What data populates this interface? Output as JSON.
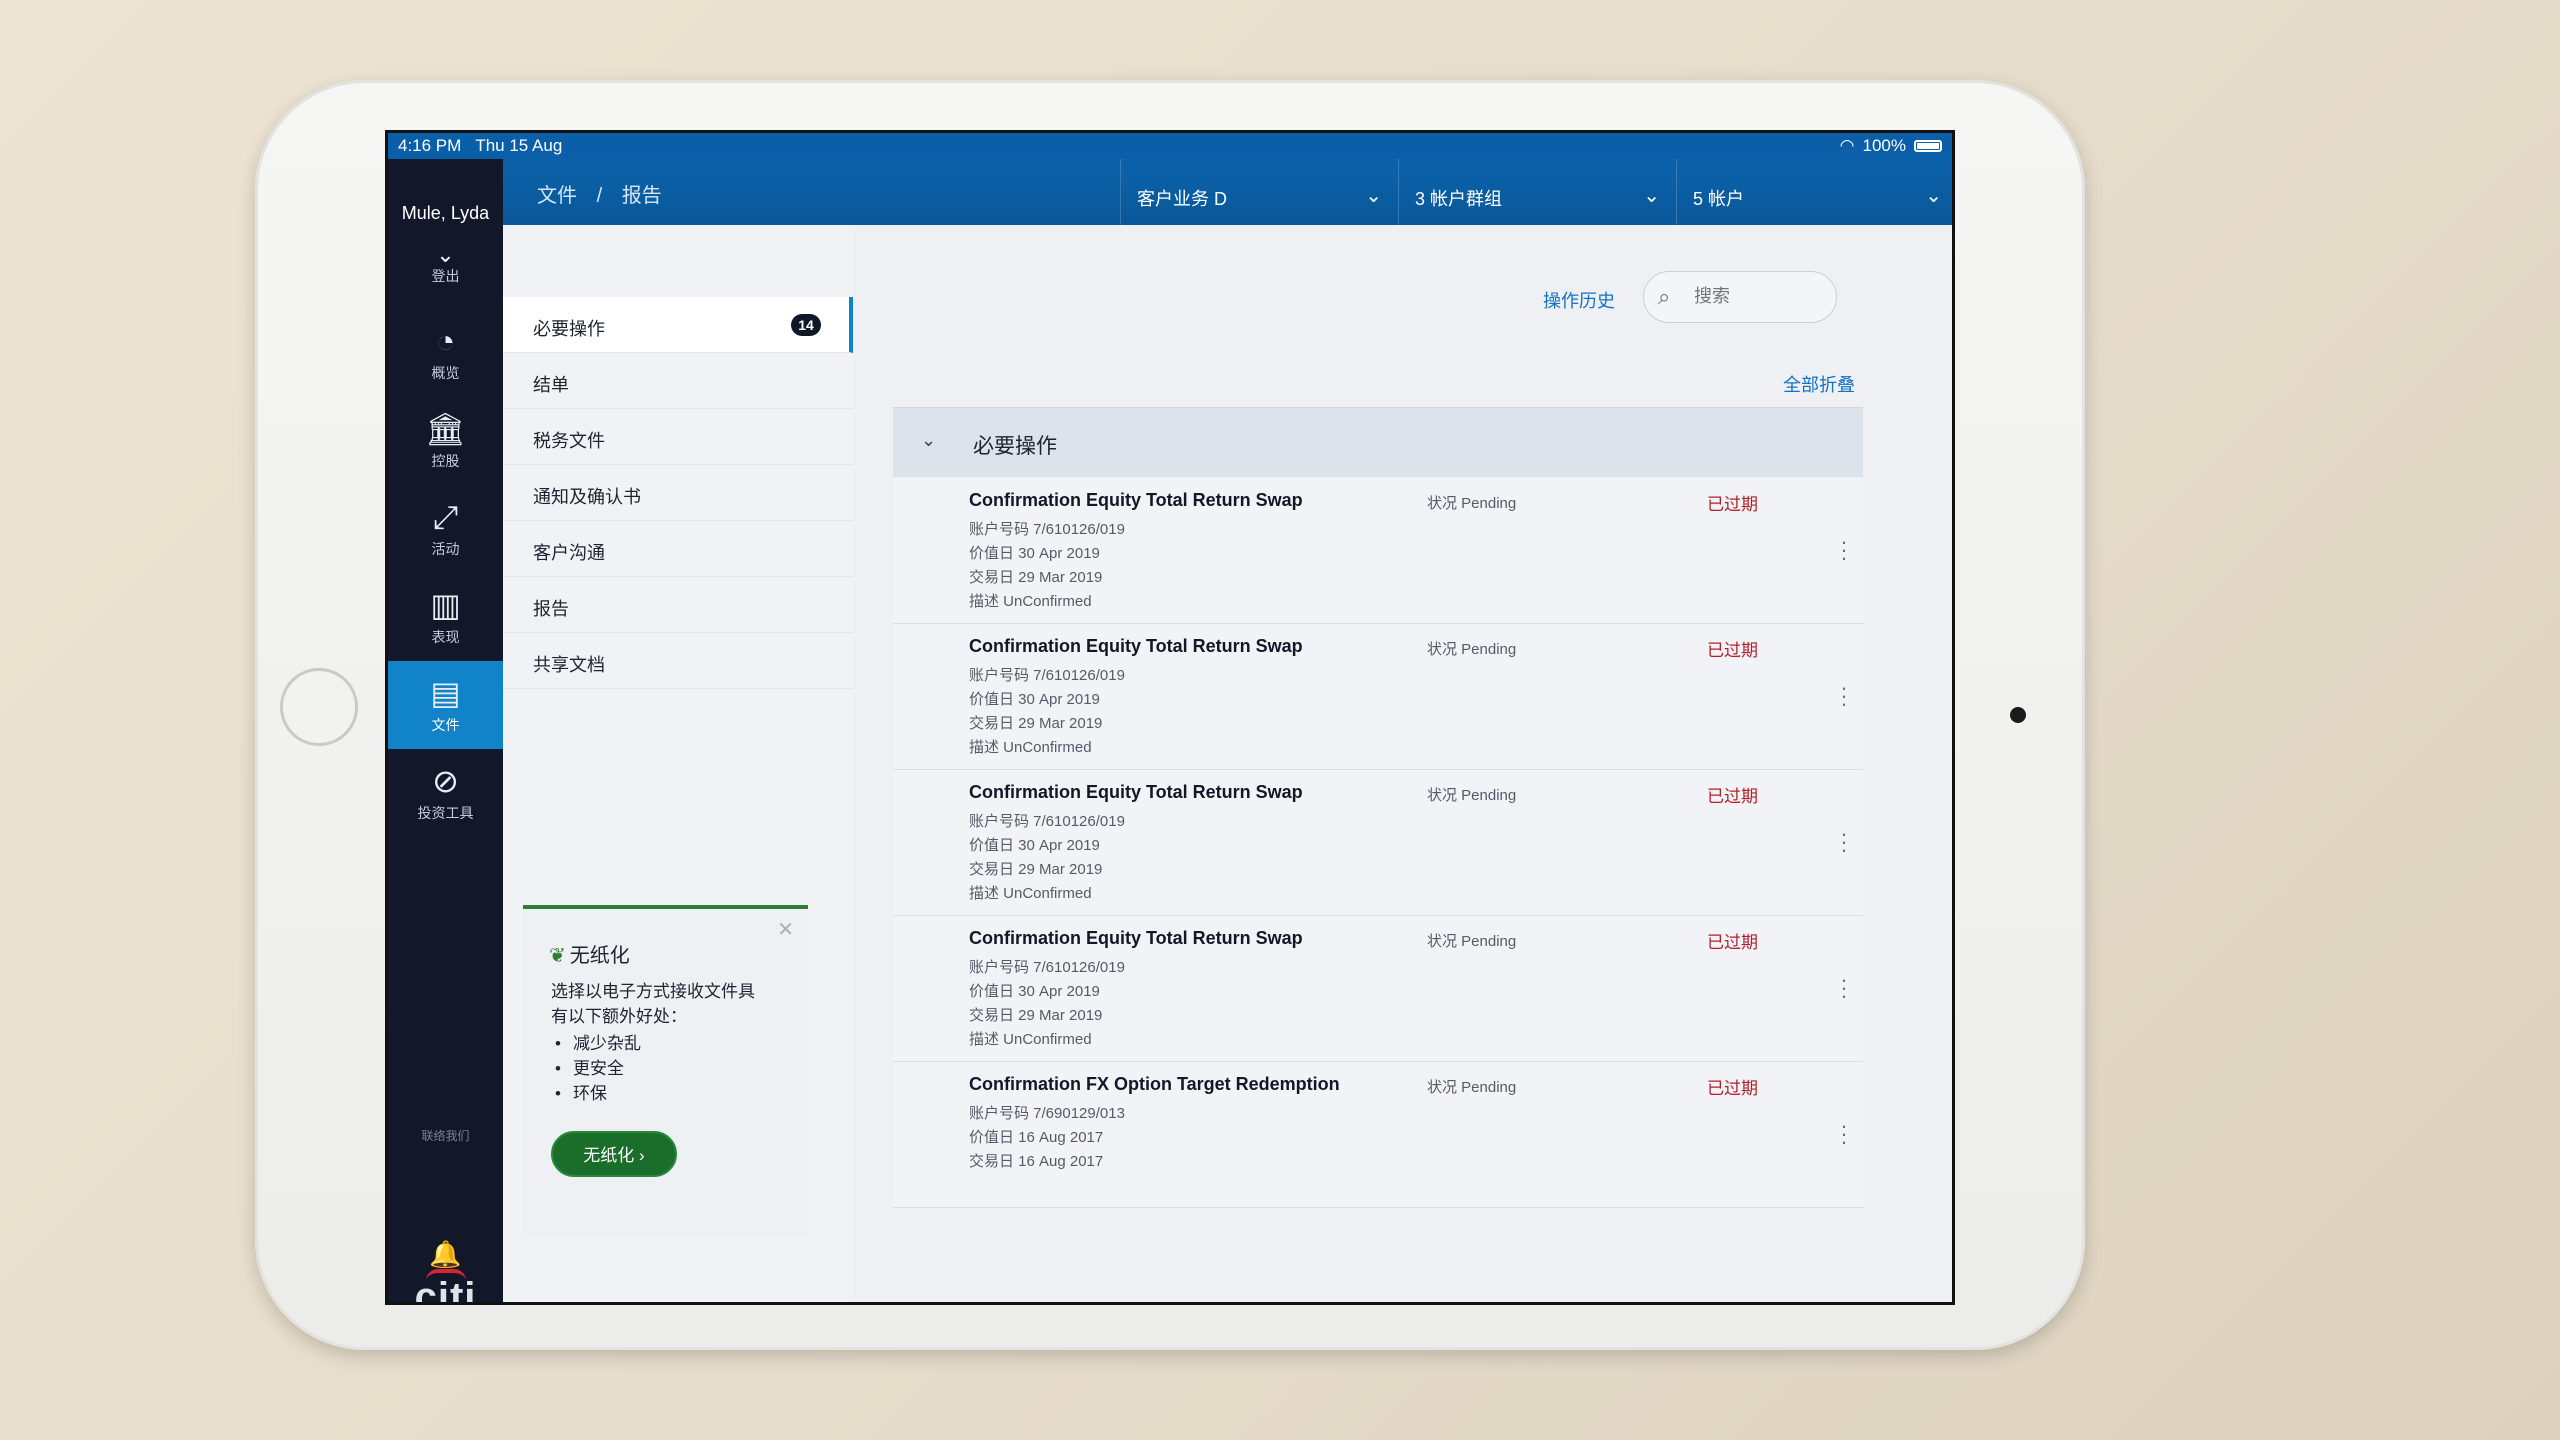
{
  "status_bar": {
    "time": "4:16 PM",
    "date": "Thu 15 Aug",
    "battery": "100%"
  },
  "user": {
    "name": "Mule, Lyda",
    "logout": "登出"
  },
  "nav": [
    {
      "label": "概览",
      "icon": "gauge-icon"
    },
    {
      "label": "控股",
      "icon": "bank-icon"
    },
    {
      "label": "活动",
      "icon": "arrows-icon"
    },
    {
      "label": "表现",
      "icon": "bar-chart-icon"
    },
    {
      "label": "文件",
      "icon": "document-icon",
      "active": true
    },
    {
      "label": "投资工具",
      "icon": "compass-icon"
    }
  ],
  "contact_us": "联络我们",
  "brand": "citi",
  "breadcrumb": [
    "文件",
    "/",
    "报告"
  ],
  "dropdowns": [
    {
      "label": "客户业务 D"
    },
    {
      "label": "3 帐户群组"
    },
    {
      "label": "5 帐户"
    }
  ],
  "side_menu": [
    {
      "label": "必要操作",
      "badge": "14",
      "active": true
    },
    {
      "label": "结单"
    },
    {
      "label": "税务文件"
    },
    {
      "label": "通知及确认书"
    },
    {
      "label": "客户沟通"
    },
    {
      "label": "报告"
    },
    {
      "label": "共享文档"
    }
  ],
  "promo": {
    "title": "无纸化",
    "text_line1": "选择以电子方式接收文件具",
    "text_line2": "有以下额外好处：",
    "benefits": [
      "减少杂乱",
      "更安全",
      "环保"
    ],
    "button": "无纸化"
  },
  "main": {
    "history_link": "操作历史",
    "search_placeholder": "搜索",
    "collapse_all": "全部折叠",
    "section_title": "必要操作",
    "rows": [
      {
        "name": "Confirmation Equity Total Return Swap",
        "account": "账户号码 7/610126/019",
        "value_date": "价值日 30 Apr 2019",
        "trade_date": "交易日 29 Mar 2019",
        "desc": "描述 UnConfirmed",
        "status": "状况 Pending",
        "expired": "已过期"
      },
      {
        "name": "Confirmation Equity Total Return Swap",
        "account": "账户号码 7/610126/019",
        "value_date": "价值日 30 Apr 2019",
        "trade_date": "交易日 29 Mar 2019",
        "desc": "描述 UnConfirmed",
        "status": "状况 Pending",
        "expired": "已过期"
      },
      {
        "name": "Confirmation Equity Total Return Swap",
        "account": "账户号码 7/610126/019",
        "value_date": "价值日 30 Apr 2019",
        "trade_date": "交易日 29 Mar 2019",
        "desc": "描述 UnConfirmed",
        "status": "状况 Pending",
        "expired": "已过期"
      },
      {
        "name": "Confirmation Equity Total Return Swap",
        "account": "账户号码 7/610126/019",
        "value_date": "价值日 30 Apr 2019",
        "trade_date": "交易日 29 Mar 2019",
        "desc": "描述 UnConfirmed",
        "status": "状况 Pending",
        "expired": "已过期"
      },
      {
        "name": "Confirmation FX Option Target Redemption",
        "account": "账户号码 7/690129/013",
        "value_date": "价值日 16 Aug 2017",
        "trade_date": "交易日 16 Aug 2017",
        "desc": "",
        "status": "状况 Pending",
        "expired": "已过期"
      }
    ]
  },
  "colors": {
    "header_blue": "#0a5fa8",
    "nav_dark": "#12182a",
    "active_blue": "#1183c9",
    "expired_red": "#b3202c",
    "promo_green": "#1b6e2a"
  }
}
